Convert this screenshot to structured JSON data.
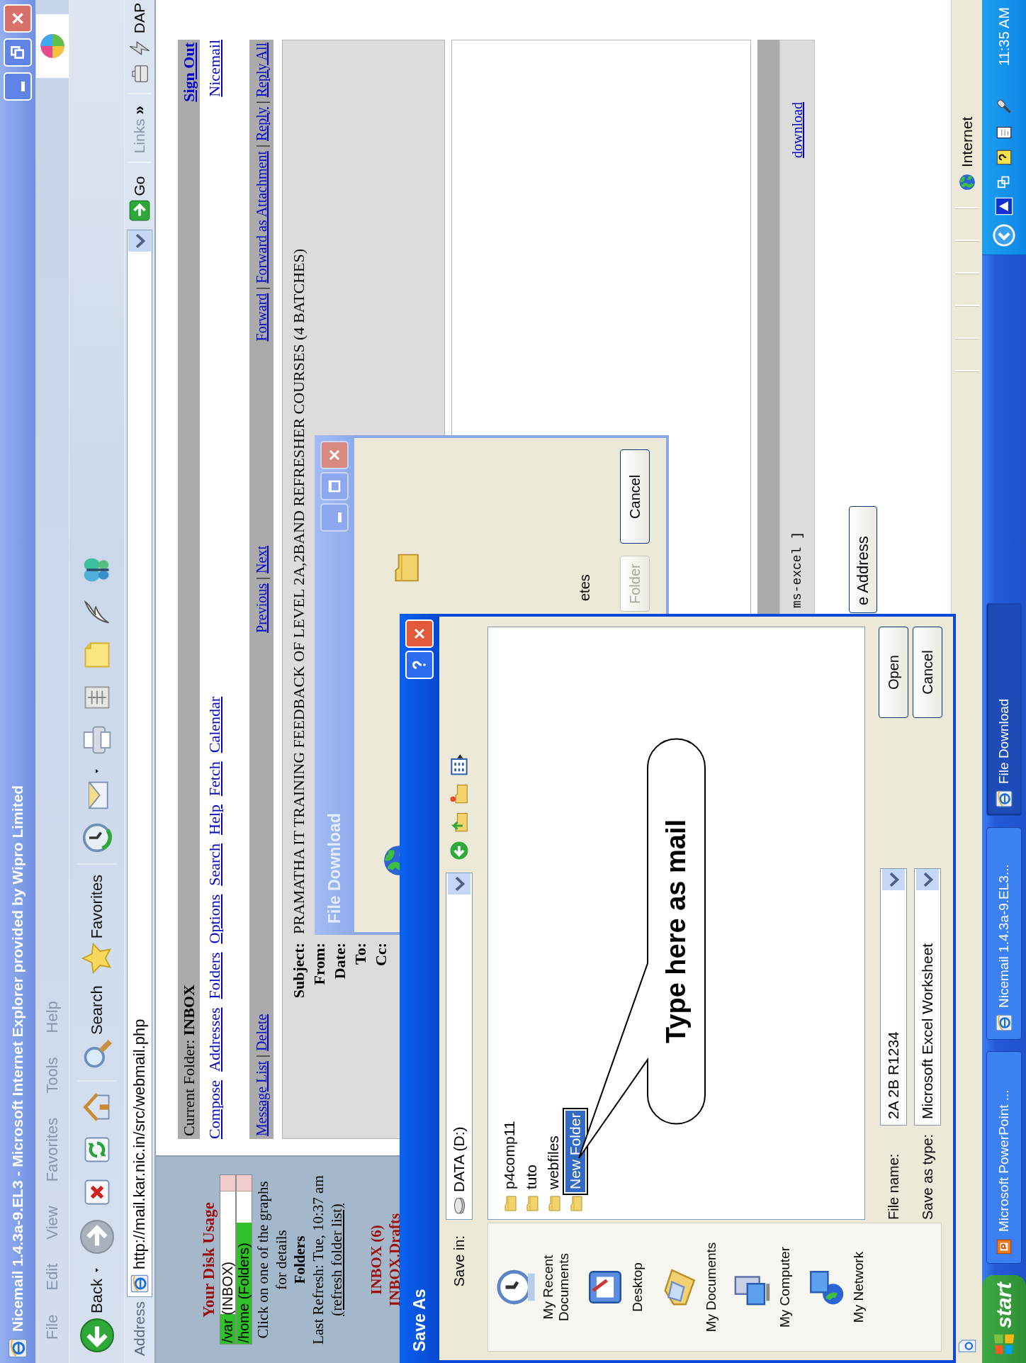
{
  "browser": {
    "title": "Nicemail 1.4.3a-9.EL3 - Microsoft Internet Explorer provided by Wipro Limited",
    "menu": [
      "File",
      "Edit",
      "View",
      "Favorites",
      "Tools",
      "Help"
    ],
    "toolbar": [
      {
        "kind": "back",
        "label": "Back"
      },
      {
        "kind": "forward"
      },
      {
        "kind": "stop"
      },
      {
        "kind": "refresh"
      },
      {
        "kind": "home"
      },
      {
        "kind": "search",
        "label": "Search"
      },
      {
        "kind": "favorites",
        "label": "Favorites"
      },
      {
        "kind": "history"
      },
      {
        "kind": "mail"
      },
      {
        "kind": "print"
      },
      {
        "kind": "edit"
      },
      {
        "kind": "note"
      },
      {
        "kind": "quill"
      },
      {
        "kind": "butterfly"
      }
    ],
    "address": {
      "label": "Address",
      "value": "http://mail.kar.nic.in/src/webmail.php",
      "go": "Go",
      "links": "Links",
      "chevron": "»",
      "extra": "DAP"
    }
  },
  "mail": {
    "sidebar": {
      "title": "Your Disk Usage",
      "usage": [
        {
          "label": "/var (INBOX)",
          "level": 0.18
        },
        {
          "label": "/home (Folders)",
          "level": 0.72
        }
      ],
      "hint": "Click on one of the graphs for details",
      "folders_title": "Folders",
      "last_refresh": "Last Refresh: Tue, 10:37 am",
      "refresh_link": "(refresh folder list)",
      "folders": [
        "INBOX (6)",
        "INBOX.Drafts"
      ]
    },
    "current_folder": "Current Folder: **INBOX**",
    "sign_out": "Sign Out",
    "nav": [
      "Compose",
      "Addresses",
      "Folders",
      "Options",
      "Search",
      "Help",
      "Fetch",
      "Calendar"
    ],
    "brand": "Nicemail",
    "separator": "|",
    "actions_left": [
      "Message List",
      "Delete"
    ],
    "actions_mid": [
      "Previous",
      "Next"
    ],
    "actions_right": [
      "Forward",
      "Forward as Attachment",
      "Reply",
      "Reply All"
    ],
    "headers": [
      {
        "label": "Subject:",
        "value": "PRAMATHA IT TRAINING FEEDBACK OF LEVEL 2A,2BAND REFRESHER COURSES (4 BATCHES)"
      },
      {
        "label": "From:"
      },
      {
        "label": "Date:"
      },
      {
        "label": "To:"
      },
      {
        "label": "Cc:"
      }
    ],
    "attachment": {
      "type_text": "ms-excel ]",
      "link": "download"
    },
    "address_button": "e Address"
  },
  "file_download": {
    "title": "File Download",
    "text": "etes",
    "buttons": [
      {
        "label": "Folder",
        "disabled": true
      },
      {
        "label": "Cancel",
        "disabled": false
      }
    ]
  },
  "save_as": {
    "title": "Save As",
    "save_in_label": "Save in:",
    "save_in": "DATA (D:)",
    "places": [
      {
        "kind": "recent",
        "label": "My Recent Documents"
      },
      {
        "kind": "desktop",
        "label": "Desktop"
      },
      {
        "kind": "documents",
        "label": "My Documents"
      },
      {
        "kind": "computer",
        "label": "My Computer"
      },
      {
        "kind": "network",
        "label": "My Network"
      }
    ],
    "files": [
      {
        "name": "p4comp11",
        "selected": false
      },
      {
        "name": "tuto",
        "selected": false
      },
      {
        "name": "webfiles",
        "selected": false
      },
      {
        "name": "New Folder",
        "selected": true
      }
    ],
    "file_name_label": "File name:",
    "file_name": "2A 2B R1234",
    "type_label": "Save as type:",
    "type": "Microsoft Excel Worksheet",
    "buttons": [
      "Open",
      "Cancel"
    ]
  },
  "callout": {
    "text": "Type here as mail"
  },
  "status_bar": {
    "zone": "Internet"
  },
  "taskbar": {
    "start": "start",
    "tasks": [
      {
        "label": "Microsoft PowerPoint ...",
        "kind": "powerpoint",
        "selected": false
      },
      {
        "label": "Nicemail 1.4.3a-9.EL3...",
        "kind": "ie",
        "selected": false
      },
      {
        "label": "File Download",
        "kind": "ie",
        "selected": true
      }
    ],
    "clock": "11:35 AM"
  }
}
